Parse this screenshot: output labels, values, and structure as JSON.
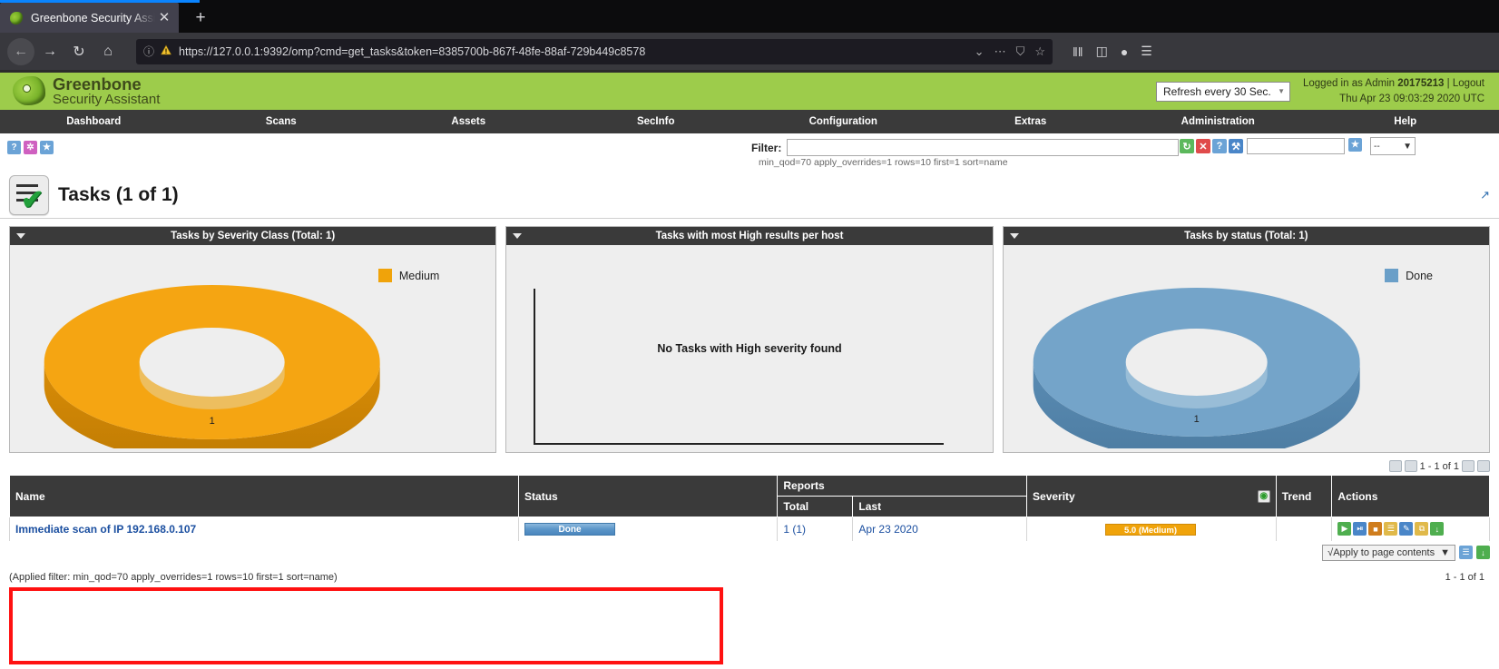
{
  "browser": {
    "tab_title": "Greenbone Security Assi",
    "tab_favicon": "dragon-icon",
    "close_label": "✕",
    "newtab_label": "+",
    "back_label": "←",
    "forward_label": "→",
    "reload_label": "↻",
    "home_label": "⌂",
    "url_host": "127.0.0.1",
    "url_prefix": "https://",
    "url_rest": ":9392/omp?cmd=get_tasks&token=8385700b-867f-48fe-88af-729b449c8578",
    "url_full": "https://127.0.0.1:9392/omp?cmd=get_tasks&token=8385700b-867f-48fe-88af-729b449c8578",
    "info_icon": "ⓘ",
    "lock_warning_icon": "⚠",
    "dropdown_icon": "⌄",
    "more_icon": "⋯",
    "shield_icon": "⛉",
    "star_icon": "☆",
    "library_icon": "‖‖",
    "sidebar_icon": "◫",
    "account_icon": "●",
    "menu_icon": "☰"
  },
  "header": {
    "brand_line1": "Greenbone",
    "brand_line2": "Security Assistant",
    "refresh_value": "Refresh every 30 Sec.",
    "refresh_arrow": "▼",
    "logged_in_prefix": "Logged in as",
    "role": "Admin",
    "username": "20175213",
    "separator": "|",
    "logout_label": "Logout",
    "datetime": "Thu Apr 23 09:03:29 2020 UTC"
  },
  "nav": {
    "items": [
      {
        "label": "Dashboard"
      },
      {
        "label": "Scans"
      },
      {
        "label": "Assets"
      },
      {
        "label": "SecInfo"
      },
      {
        "label": "Configuration"
      },
      {
        "label": "Extras"
      },
      {
        "label": "Administration"
      },
      {
        "label": "Help"
      }
    ]
  },
  "corner_icons": [
    {
      "name": "help-icon",
      "glyph": "?"
    },
    {
      "name": "extras-icon",
      "glyph": "✲"
    },
    {
      "name": "favorite-icon",
      "glyph": "★"
    }
  ],
  "filter": {
    "label": "Filter:",
    "value": "",
    "placeholder": "",
    "summary": "min_qod=70 apply_overrides=1 rows=10 first=1 sort=name",
    "icons": [
      {
        "name": "refresh-filter-icon",
        "glyph": "↻",
        "color": "green"
      },
      {
        "name": "reset-filter-icon",
        "glyph": "✕",
        "color": "red"
      },
      {
        "name": "filter-help-icon",
        "glyph": "?",
        "color": "blue"
      },
      {
        "name": "edit-filter-icon",
        "glyph": "⚒",
        "color": "wrench"
      }
    ],
    "name_input_value": "",
    "star_glyph": "★",
    "select_value": "--",
    "select_arrow": "▼"
  },
  "page": {
    "title": "Tasks (1 of 1)",
    "icon": "tasks-checklist-icon",
    "export_icon": "↗"
  },
  "chart_data": [
    {
      "type": "pie",
      "title": "Tasks by Severity Class (Total: 1)",
      "labels": [
        "Medium"
      ],
      "values": [
        1
      ],
      "colors": [
        "#f0a30a"
      ],
      "legend": [
        {
          "label": "Medium",
          "color": "#f0a30a"
        }
      ],
      "data_label": "1"
    },
    {
      "type": "bar",
      "title": "Tasks with most High results per host",
      "categories": [],
      "values": [],
      "empty_message": "No Tasks with High severity found",
      "xlabel": "",
      "ylabel": ""
    },
    {
      "type": "pie",
      "title": "Tasks by status (Total: 1)",
      "labels": [
        "Done"
      ],
      "values": [
        1
      ],
      "colors": [
        "#6a9fc8"
      ],
      "legend": [
        {
          "label": "Done",
          "color": "#6a9fc8"
        }
      ],
      "data_label": "1"
    }
  ],
  "table": {
    "top_pager": {
      "range": "1 - 1 of 1"
    },
    "bottom_pager": {
      "range": "1 - 1 of 1"
    },
    "columns": {
      "name": "Name",
      "status": "Status",
      "reports": "Reports",
      "reports_total": "Total",
      "reports_last": "Last",
      "severity": "Severity",
      "trend": "Trend",
      "actions": "Actions"
    },
    "severity_head_icon": "◔",
    "rows": [
      {
        "name": "Immediate scan of IP 192.168.0.107",
        "status": "Done",
        "reports_total": "1 (1)",
        "reports_last": "Apr 23 2020",
        "severity": "5.0 (Medium)",
        "severity_color": "#f0a30a",
        "trend": "",
        "actions": [
          {
            "name": "start-task-icon",
            "glyph": "▶",
            "color": "play"
          },
          {
            "name": "resume-task-icon",
            "glyph": "⏯",
            "color": "pause"
          },
          {
            "name": "stop-task-icon",
            "glyph": "■",
            "color": "stop"
          },
          {
            "name": "move-to-trash-icon",
            "glyph": "☰",
            "color": "trash"
          },
          {
            "name": "edit-task-icon",
            "glyph": "✎",
            "color": "edit"
          },
          {
            "name": "clone-task-icon",
            "glyph": "⧉",
            "color": "copy"
          },
          {
            "name": "export-task-icon",
            "glyph": "↓",
            "color": "export"
          }
        ]
      }
    ],
    "apply_to_page": "√Apply to page contents",
    "apply_arrow": "▼",
    "footer_icons": [
      {
        "name": "trashcan-icon",
        "glyph": "☰",
        "color": "blue"
      },
      {
        "name": "export-all-icon",
        "glyph": "↓",
        "color": "green"
      }
    ],
    "applied_filter": "(Applied filter: min_qod=70 apply_overrides=1 rows=10 first=1 sort=name)"
  }
}
